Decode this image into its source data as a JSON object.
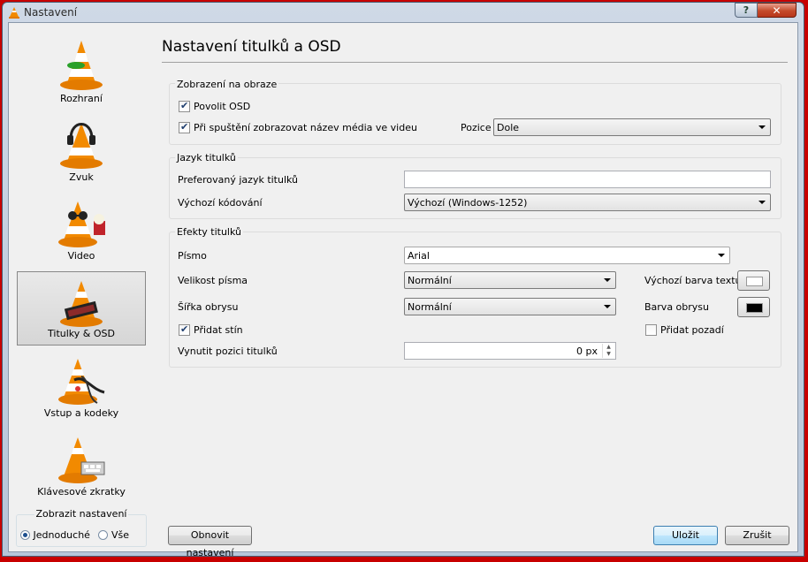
{
  "window": {
    "title": "Nastavení",
    "help_label": "?",
    "close_label": "✕"
  },
  "sidebar": {
    "items": [
      {
        "label": "Rozhraní",
        "icon": "vlc-cone-icon",
        "selected": false
      },
      {
        "label": "Zvuk",
        "icon": "cone-headphones-icon",
        "selected": false
      },
      {
        "label": "Video",
        "icon": "cone-glasses-icon",
        "selected": false
      },
      {
        "label": "Titulky & OSD",
        "icon": "cone-subtitles-icon",
        "selected": true
      },
      {
        "label": "Vstup a kodeky",
        "icon": "cone-cables-icon",
        "selected": false
      },
      {
        "label": "Klávesové zkratky",
        "icon": "cone-keyboard-icon",
        "selected": false
      }
    ],
    "show_settings": {
      "legend": "Zobrazit nastavení",
      "simple": "Jednoduché",
      "all": "Vše",
      "selected": "simple"
    }
  },
  "main": {
    "title": "Nastavení titulků a OSD",
    "osd_group": {
      "title": "Zobrazení na obraze",
      "enable_osd": {
        "label": "Povolit OSD",
        "checked": true
      },
      "show_title": {
        "label": "Při spuštění zobrazovat název média ve videu",
        "checked": true
      },
      "position_label": "Pozice",
      "position_value": "Dole"
    },
    "lang_group": {
      "title": "Jazyk titulků",
      "preferred_label": "Preferovaný jazyk titulků",
      "preferred_value": "",
      "encoding_label": "Výchozí kódování",
      "encoding_value": "Výchozí (Windows-1252)"
    },
    "effects_group": {
      "title": "Efekty titulků",
      "font_label": "Písmo",
      "font_value": "Arial",
      "size_label": "Velikost písma",
      "size_value": "Normální",
      "outline_label": "Šířka obrysu",
      "outline_value": "Normální",
      "shadow": {
        "label": "Přidat stín",
        "checked": true
      },
      "force_pos_label": "Vynutit pozici titulků",
      "force_pos_value": "0 px",
      "text_color_label": "Výchozí barva textu",
      "text_color": "#ffffff",
      "outline_color_label": "Barva obrysu",
      "outline_color": "#000000",
      "background": {
        "label": "Přidat pozadí",
        "checked": false
      }
    }
  },
  "footer": {
    "reset_label": "Obnovit nastavení",
    "save_label": "Uložit",
    "cancel_label": "Zrušit"
  }
}
